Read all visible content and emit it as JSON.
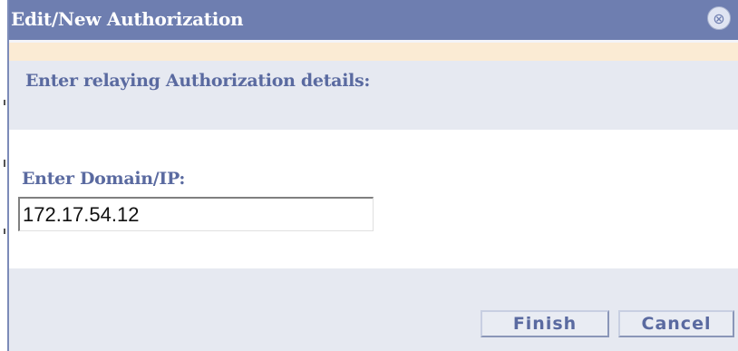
{
  "dialog": {
    "title": "Edit/New Authorization",
    "close_symbol": "⊗",
    "section_header": "Enter relaying Authorization details:",
    "domain_label": "Enter Domain/IP:",
    "domain_value": "172.17.54.12",
    "buttons": {
      "finish": "Finish",
      "cancel": "Cancel"
    }
  },
  "icons": [
    "close-icon"
  ],
  "colors": {
    "titlebar": "#6e7eb0",
    "accent_text": "#5a6aa0",
    "notice_strip": "#fbebd4",
    "panel": "#e6e9f1"
  }
}
